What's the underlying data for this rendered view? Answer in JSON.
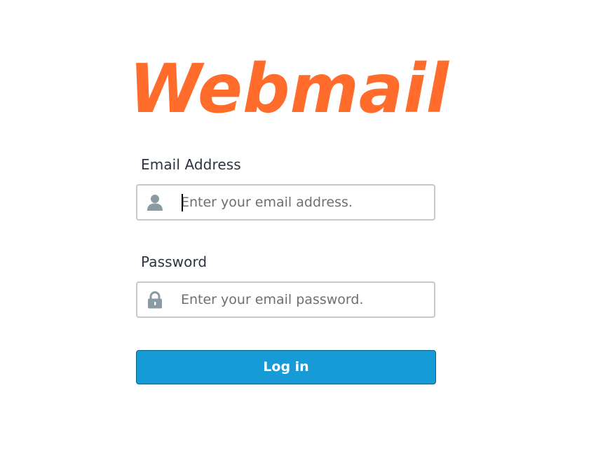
{
  "logo": {
    "text": "Webmail",
    "color": "#ff6c2c"
  },
  "email": {
    "label": "Email Address",
    "placeholder": "Enter your email address.",
    "icon": "user-icon"
  },
  "password": {
    "label": "Password",
    "placeholder": "Enter your email password.",
    "icon": "lock-icon"
  },
  "login_button": {
    "label": "Log in",
    "color": "#179bd7"
  },
  "colors": {
    "label_text": "#2b3440",
    "input_border": "#c8c8c8",
    "icon_gray": "#8a9ba4"
  }
}
